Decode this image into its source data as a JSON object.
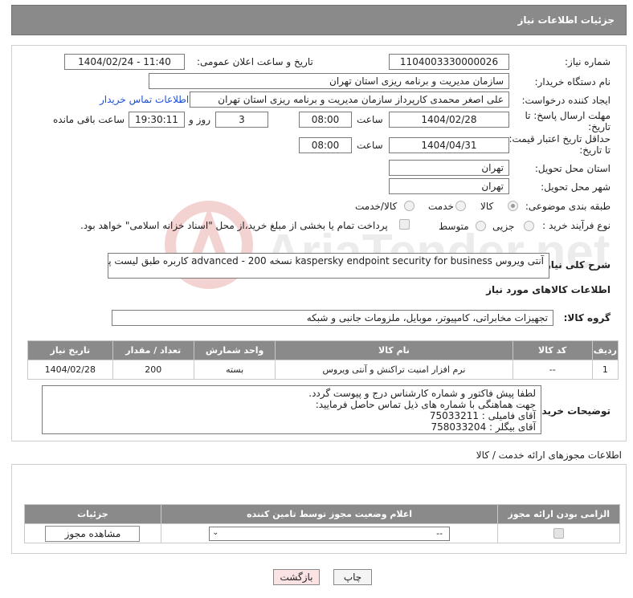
{
  "header": {
    "title": "جزئیات اطلاعات نیاز"
  },
  "labels": {
    "need_number": "شماره نیاز:",
    "announce_datetime": "تاریخ و ساعت اعلان عمومی:",
    "buyer_org": "نام دستگاه خریدار:",
    "requester": "ایجاد کننده درخواست:",
    "reply_deadline": "مهلت ارسال پاسخ: تا تاریخ:",
    "price_validity": "حداقل تاریخ اعتبار قیمت: تا تاریخ:",
    "hour": "ساعت",
    "hour2": "ساعت",
    "day_and": "روز و",
    "remaining": "ساعت باقی مانده",
    "province": "استان محل تحویل:",
    "city": "شهر محل تحویل:",
    "category": "طبقه بندی موضوعی:",
    "purchase_type": "نوع فرآیند خرید :",
    "description": "شرح کلی نیاز:",
    "goods_info": "اطلاعات کالاهای مورد نیاز",
    "goods_group": "گروه کالا:",
    "buyer_notes": "توضیحات خریدار:"
  },
  "form": {
    "need_number": "1104003330000026",
    "announce_datetime": "1404/02/24 - 11:40",
    "buyer_org": "سازمان مدیریت و برنامه ریزی استان تهران",
    "requester": "علی اصغر محمدی کارپرداز سازمان مدیریت و برنامه ریزی استان تهران",
    "contact_link": "اطلاعات تماس خریدار",
    "reply_date": "1404/02/28",
    "reply_time": "08:00",
    "days": "3",
    "remaining_time": "19:30:11",
    "validity_date": "1404/04/31",
    "validity_time": "08:00",
    "province": "تهران",
    "city": "تهران",
    "category_options": [
      "کالا",
      "خدمت",
      "کالا/خدمت"
    ],
    "category_selected": "کالا",
    "purchase_options": [
      "جزیی",
      "متوسط"
    ],
    "payment_note": "پرداخت تمام یا بخشی از مبلغ خرید،از محل \"اسناد خزانه اسلامی\" خواهد بود.",
    "description": "آنتی ویروس kaspersky endpoint security for business  نسخه advanced  - 200 کاربره طبق لیست پیوست",
    "goods_group": "تجهیزات مخابراتی، کامپیوتر، موبایل، ملزومات جانبی و شبکه",
    "buyer_notes": "لطفا پیش فاکتور و شماره کارشناس درج و پیوست گردد.\nجهت هماهنگی با شماره های ذیل تماس حاصل فرمایید:\nآقای فامیلی : 75033211\nآقای بیگلر : 758033204"
  },
  "goods_table": {
    "headers": [
      "ردیف",
      "کد کالا",
      "نام کالا",
      "واحد شمارش",
      "تعداد / مقدار",
      "تاریخ نیاز"
    ],
    "rows": [
      [
        "1",
        "--",
        "نرم افزار امنیت تراکنش و آنتی ویروس",
        "بسته",
        "200",
        "1404/02/28"
      ]
    ]
  },
  "permits": {
    "title": "اطلاعات مجوزهای ارائه خدمت / کالا",
    "headers": [
      "الزامی بودن ارائه مجوز",
      "اعلام وضعیت مجوز توسط تامین کننده",
      "جزئیات"
    ],
    "select_value": "--",
    "view_button": "مشاهده مجوز"
  },
  "buttons": {
    "print": "چاپ",
    "back": "بازگشت"
  },
  "watermark": {
    "text": "AriaTender.net"
  }
}
